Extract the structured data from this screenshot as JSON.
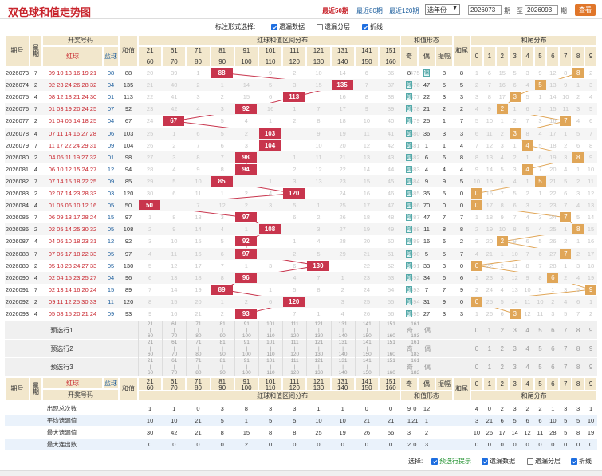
{
  "header": {
    "title": "双色球和值走势图",
    "links": [
      "最近50期",
      "最近80期",
      "最近120期"
    ],
    "year_select": "选年份",
    "from": "2026073",
    "to": "2026093",
    "qi1": "期",
    "zhi": "至",
    "qi2": "期",
    "query": "查看"
  },
  "options": {
    "label": "标注形式选择:",
    "items": [
      {
        "label": "遗漏数据",
        "checked": true
      },
      {
        "label": "遗漏分层",
        "checked": false
      },
      {
        "label": "折线",
        "checked": true
      }
    ]
  },
  "head": {
    "issue": "期号",
    "week": "星期",
    "kaijiang": "开奖号码",
    "red": "红球",
    "blue": "蓝球",
    "sum": "和值",
    "sumzone": "红球和值区间分布",
    "shape": "和值形态",
    "ji": "奇",
    "ou": "偶",
    "zhenfu": "振幅",
    "tail": "和尾",
    "tailzone": "和尾分布"
  },
  "ranges": [
    [
      "21",
      "60"
    ],
    [
      "61",
      "70"
    ],
    [
      "71",
      "80"
    ],
    [
      "81",
      "90"
    ],
    [
      "91",
      "100"
    ],
    [
      "101",
      "110"
    ],
    [
      "111",
      "120"
    ],
    [
      "121",
      "130"
    ],
    [
      "131",
      "140"
    ],
    [
      "141",
      "150"
    ],
    [
      "151",
      "160"
    ],
    [
      "161",
      "183"
    ]
  ],
  "tail_digits": [
    "0",
    "1",
    "2",
    "3",
    "4",
    "5",
    "6",
    "7",
    "8",
    "9"
  ],
  "rows": [
    {
      "issue": "2026073",
      "week": "7",
      "red": "09 10 13 16 19 21",
      "blue": "08",
      "sum": "88",
      "zone": 3,
      "zvals": [
        "20",
        "39",
        "1",
        "",
        "9",
        "2",
        "10",
        "14",
        "6",
        "36",
        "475"
      ],
      "ji": "8",
      "ou": "",
      "oi": 0,
      "zf": "8",
      "tail": 8,
      "tvals": [
        "1",
        "6",
        "15",
        "5",
        "3",
        "9",
        "12",
        "8",
        "",
        "2"
      ],
      "tt": "8"
    },
    {
      "issue": "2026074",
      "week": "2",
      "red": "02 23 24 26 28 32",
      "blue": "04",
      "sum": "135",
      "zone": 8,
      "zvals": [
        "21",
        "40",
        "2",
        "1",
        "14",
        "5",
        "3",
        "15",
        "7",
        "37",
        "476"
      ],
      "ji": "",
      "ou": "47",
      "oi": 1,
      "zf": "5",
      "tail": 5,
      "tvals": [
        "2",
        "7",
        "16",
        "6",
        "4",
        "",
        "13",
        "9",
        "1",
        "3"
      ],
      "tt": "5"
    },
    {
      "issue": "2026075",
      "week": "4",
      "red": "08 12 18 21 24 30",
      "blue": "01",
      "sum": "113",
      "zone": 6,
      "zvals": [
        "22",
        "41",
        "3",
        "2",
        "15",
        "6",
        "",
        "16",
        "8",
        "38",
        "477"
      ],
      "ji": "",
      "ou": "22",
      "oi": 1,
      "zf": "3",
      "tail": 3,
      "tvals": [
        "3",
        "8",
        "17",
        "",
        "5",
        "1",
        "14",
        "10",
        "2",
        "4"
      ],
      "tt": "3"
    },
    {
      "issue": "2026076",
      "week": "7",
      "red": "01 03 19 20 24 25",
      "blue": "07",
      "sum": "92",
      "zone": 4,
      "zvals": [
        "23",
        "42",
        "4",
        "3",
        "16",
        "1",
        "7",
        "17",
        "9",
        "39",
        "478"
      ],
      "ji": "",
      "ou": "21",
      "oi": 1,
      "zf": "2",
      "tail": 2,
      "tvals": [
        "4",
        "9",
        "",
        "1",
        "6",
        "2",
        "15",
        "11",
        "3",
        "5"
      ],
      "tt": "2"
    },
    {
      "issue": "2026077",
      "week": "2",
      "red": "01 04 05 14 18 25",
      "blue": "04",
      "sum": "67",
      "zone": 1,
      "zvals": [
        "24",
        "",
        "5",
        "4",
        "1",
        "2",
        "8",
        "18",
        "10",
        "40",
        "479"
      ],
      "ji": "",
      "ou": "25",
      "oi": 1,
      "zf": "1",
      "tail": 7,
      "tvals": [
        "5",
        "10",
        "1",
        "2",
        "7",
        "3",
        "16",
        "",
        "4",
        "6"
      ],
      "tt": "7"
    },
    {
      "issue": "2026078",
      "week": "4",
      "red": "07 11 14 16 27 28",
      "blue": "06",
      "sum": "103",
      "zone": 5,
      "zvals": [
        "25",
        "1",
        "6",
        "5",
        "2",
        "",
        "9",
        "19",
        "11",
        "41",
        "480"
      ],
      "ji": "",
      "ou": "36",
      "oi": 1,
      "zf": "3",
      "tail": 3,
      "tvals": [
        "6",
        "11",
        "2",
        "",
        "8",
        "4",
        "17",
        "1",
        "5",
        "7"
      ],
      "tt": "3"
    },
    {
      "issue": "2026079",
      "week": "7",
      "red": "11 17 22 24 29 31",
      "blue": "09",
      "sum": "104",
      "zone": 5,
      "zvals": [
        "26",
        "2",
        "7",
        "6",
        "3",
        "",
        "10",
        "20",
        "12",
        "42",
        "481"
      ],
      "ji": "",
      "ou": "1",
      "oi": 1,
      "zf": "1",
      "tail": 4,
      "tvals": [
        "7",
        "12",
        "3",
        "1",
        "",
        "5",
        "18",
        "2",
        "6",
        "8"
      ],
      "tt": "4"
    },
    {
      "issue": "2026080",
      "week": "2",
      "red": "04 05 11 19 27 32",
      "blue": "01",
      "sum": "98",
      "zone": 4,
      "zvals": [
        "27",
        "3",
        "8",
        "7",
        "",
        "1",
        "11",
        "21",
        "13",
        "43",
        "482"
      ],
      "ji": "",
      "ou": "6",
      "oi": 1,
      "zf": "6",
      "tail": 8,
      "tvals": [
        "8",
        "13",
        "4",
        "2",
        "1",
        "6",
        "19",
        "3",
        "",
        "9"
      ],
      "tt": "8"
    },
    {
      "issue": "2026081",
      "week": "4",
      "red": "06 10 12 15 24 27",
      "blue": "12",
      "sum": "94",
      "zone": 4,
      "zvals": [
        "28",
        "4",
        "9",
        "8",
        "",
        "2",
        "12",
        "22",
        "14",
        "44",
        "483"
      ],
      "ji": "",
      "ou": "4",
      "oi": 1,
      "zf": "4",
      "tail": 4,
      "tvals": [
        "9",
        "14",
        "5",
        "3",
        "",
        "7",
        "20",
        "4",
        "1",
        "10"
      ],
      "tt": "4"
    },
    {
      "issue": "2026082",
      "week": "7",
      "red": "07 14 15 18 22 25",
      "blue": "09",
      "sum": "85",
      "zone": 3,
      "zvals": [
        "29",
        "5",
        "10",
        "",
        "1",
        "3",
        "13",
        "23",
        "15",
        "45",
        "484"
      ],
      "ji": "",
      "ou": "9",
      "oi": 1,
      "zf": "9",
      "tail": 5,
      "tvals": [
        "10",
        "15",
        "6",
        "4",
        "1",
        "",
        "21",
        "5",
        "2",
        "11"
      ],
      "tt": "5"
    },
    {
      "issue": "2026083",
      "week": "2",
      "red": "02 07 14 23 28 33",
      "blue": "03",
      "sum": "120",
      "zone": 6,
      "zvals": [
        "30",
        "6",
        "11",
        "1",
        "2",
        "4",
        "",
        "24",
        "16",
        "46",
        "485"
      ],
      "ji": "",
      "ou": "35",
      "oi": 1,
      "zf": "5",
      "tail": 0,
      "tvals": [
        "",
        "16",
        "7",
        "5",
        "2",
        "1",
        "22",
        "6",
        "3",
        "12"
      ],
      "tt": "0"
    },
    {
      "issue": "2026084",
      "week": "4",
      "red": "01 05 06 10 12 16",
      "blue": "05",
      "sum": "50",
      "zone": 0,
      "zvals": [
        "",
        "7",
        "12",
        "2",
        "3",
        "5",
        "1",
        "25",
        "17",
        "47",
        "486"
      ],
      "ji": "",
      "ou": "70",
      "oi": 1,
      "zf": "0",
      "tail": 0,
      "tvals": [
        "",
        "17",
        "8",
        "6",
        "3",
        "2",
        "23",
        "7",
        "4",
        "13"
      ],
      "tt": "0"
    },
    {
      "issue": "2026085",
      "week": "7",
      "red": "06 09 13 17 28 24",
      "blue": "15",
      "sum": "97",
      "zone": 4,
      "zvals": [
        "1",
        "8",
        "13",
        "3",
        "",
        "6",
        "2",
        "26",
        "18",
        "48",
        "487"
      ],
      "ji": "",
      "ou": "47",
      "oi": 1,
      "zf": "7",
      "tail": 7,
      "tvals": [
        "1",
        "18",
        "9",
        "7",
        "4",
        "3",
        "24",
        "",
        "5",
        "14"
      ],
      "tt": "7"
    },
    {
      "issue": "2026086",
      "week": "2",
      "red": "02 05 14 25 30 32",
      "blue": "05",
      "sum": "108",
      "zone": 5,
      "zvals": [
        "2",
        "9",
        "14",
        "4",
        "1",
        "",
        "3",
        "27",
        "19",
        "49",
        "488"
      ],
      "ji": "",
      "ou": "11",
      "oi": 1,
      "zf": "8",
      "tail": 8,
      "tvals": [
        "2",
        "19",
        "10",
        "8",
        "5",
        "4",
        "25",
        "1",
        "",
        "15"
      ],
      "tt": "8"
    },
    {
      "issue": "2026087",
      "week": "4",
      "red": "04 06 10 18 23 31",
      "blue": "12",
      "sum": "92",
      "zone": 4,
      "zvals": [
        "3",
        "10",
        "15",
        "5",
        "",
        "1",
        "4",
        "28",
        "20",
        "50",
        "489"
      ],
      "ji": "",
      "ou": "16",
      "oi": 1,
      "zf": "6",
      "tail": 2,
      "tvals": [
        "3",
        "20",
        "",
        "9",
        "6",
        "5",
        "26",
        "2",
        "1",
        "16"
      ],
      "tt": "2"
    },
    {
      "issue": "2026088",
      "week": "7",
      "red": "07 06 17 18 22 33",
      "blue": "05",
      "sum": "97",
      "zone": 4,
      "zvals": [
        "4",
        "11",
        "16",
        "6",
        "",
        "2",
        "5",
        "29",
        "21",
        "51",
        "490"
      ],
      "ji": "",
      "ou": "5",
      "oi": 1,
      "zf": "5",
      "tail": 7,
      "tvals": [
        "4",
        "21",
        "1",
        "10",
        "7",
        "6",
        "27",
        "",
        "2",
        "17"
      ],
      "tt": "7"
    },
    {
      "issue": "2026089",
      "week": "2",
      "red": "05 18 23 24 27 33",
      "blue": "05",
      "sum": "130",
      "zone": 7,
      "zvals": [
        "5",
        "12",
        "17",
        "7",
        "1",
        "3",
        "6",
        "",
        "22",
        "52",
        "491"
      ],
      "ji": "",
      "ou": "33",
      "oi": 1,
      "zf": "3",
      "tail": 0,
      "tvals": [
        "",
        "22",
        "2",
        "11",
        "8",
        "7",
        "28",
        "1",
        "3",
        "18"
      ],
      "tt": "0"
    },
    {
      "issue": "2026090",
      "week": "4",
      "red": "02 04 15 23 25 27",
      "blue": "04",
      "sum": "96",
      "zone": 4,
      "zvals": [
        "6",
        "13",
        "18",
        "8",
        "",
        "4",
        "7",
        "1",
        "23",
        "53",
        "492"
      ],
      "ji": "",
      "ou": "34",
      "oi": 1,
      "zf": "6",
      "tail": 6,
      "tvals": [
        "1",
        "23",
        "3",
        "12",
        "9",
        "8",
        "",
        "2",
        "4",
        "19"
      ],
      "tt": "6"
    },
    {
      "issue": "2026091",
      "week": "7",
      "red": "02 13 14 16 20 24",
      "blue": "15",
      "sum": "89",
      "zone": 3,
      "zvals": [
        "7",
        "14",
        "19",
        "",
        "1",
        "5",
        "8",
        "2",
        "24",
        "54",
        "493"
      ],
      "ji": "",
      "ou": "7",
      "oi": 1,
      "zf": "7",
      "tail": 9,
      "tvals": [
        "2",
        "24",
        "4",
        "13",
        "10",
        "9",
        "1",
        "3",
        "5",
        ""
      ],
      "tt": "9"
    },
    {
      "issue": "2026092",
      "week": "2",
      "red": "09 11 12 25 30 33",
      "blue": "11",
      "sum": "120",
      "zone": 6,
      "zvals": [
        "8",
        "15",
        "20",
        "1",
        "2",
        "6",
        "",
        "3",
        "25",
        "55",
        "494"
      ],
      "ji": "",
      "ou": "31",
      "oi": 1,
      "zf": "9",
      "tail": 0,
      "tvals": [
        "",
        "25",
        "5",
        "14",
        "11",
        "10",
        "2",
        "4",
        "6",
        "1"
      ],
      "tt": "0"
    },
    {
      "issue": "2026093",
      "week": "4",
      "red": "05 08 15 20 21 24",
      "blue": "09",
      "sum": "93",
      "zone": 4,
      "zvals": [
        "9",
        "16",
        "21",
        "2",
        "",
        "7",
        "1",
        "4",
        "26",
        "56",
        "495"
      ],
      "ji": "",
      "ou": "27",
      "oi": 1,
      "zf": "3",
      "tail": 3,
      "tvals": [
        "1",
        "26",
        "6",
        "",
        "12",
        "11",
        "3",
        "5",
        "7",
        "2"
      ],
      "tt": "3"
    }
  ],
  "preselect": [
    "预选行1",
    "预选行2",
    "预选行3"
  ],
  "stats": [
    {
      "label": "出现总次数",
      "zone": [
        "1",
        "1",
        "0",
        "3",
        "8",
        "3",
        "3",
        "1",
        "1",
        "0",
        "0",
        "0"
      ],
      "shape": [
        "9",
        "12",
        ""
      ],
      "zf": "",
      "tail": [
        "4",
        "0",
        "2",
        "3",
        "2",
        "2",
        "1",
        "3",
        "3",
        "1"
      ]
    },
    {
      "label": "平均遗漏值",
      "zone": [
        "10",
        "10",
        "21",
        "5",
        "1",
        "5",
        "5",
        "10",
        "10",
        "21",
        "21",
        "21"
      ],
      "shape": [
        "1",
        "1",
        ""
      ],
      "zf": "",
      "tail": [
        "3",
        "21",
        "6",
        "5",
        "6",
        "6",
        "10",
        "5",
        "5",
        "10"
      ]
    },
    {
      "label": "最大遗漏值",
      "zone": [
        "30",
        "42",
        "21",
        "8",
        "15",
        "8",
        "8",
        "25",
        "19",
        "26",
        "56",
        ""
      ],
      "shape": [
        "3",
        "2",
        ""
      ],
      "zf": "",
      "tail": [
        "10",
        "26",
        "17",
        "14",
        "12",
        "11",
        "28",
        "5",
        "8",
        "19"
      ]
    },
    {
      "label": "最大连出数",
      "zone": [
        "0",
        "0",
        "0",
        "0",
        "2",
        "0",
        "0",
        "0",
        "0",
        "0",
        "0",
        "0"
      ],
      "shape": [
        "2",
        "3",
        ""
      ],
      "zf": "",
      "tail": [
        "0",
        "0",
        "0",
        "0",
        "0",
        "0",
        "0",
        "0",
        "0",
        "0"
      ]
    }
  ],
  "footer": {
    "label": "选择:",
    "items": [
      {
        "label": "预选行提示",
        "checked": true
      },
      {
        "label": "遗漏数据",
        "checked": true
      },
      {
        "label": "遗漏分层",
        "checked": false
      },
      {
        "label": "折线",
        "checked": true
      }
    ]
  },
  "colors": {
    "red": "#c8242c",
    "blue": "#1a5c9c",
    "ball": "#c8354d",
    "tailball": "#e0a658",
    "header_bg": "#f2e7cc"
  }
}
